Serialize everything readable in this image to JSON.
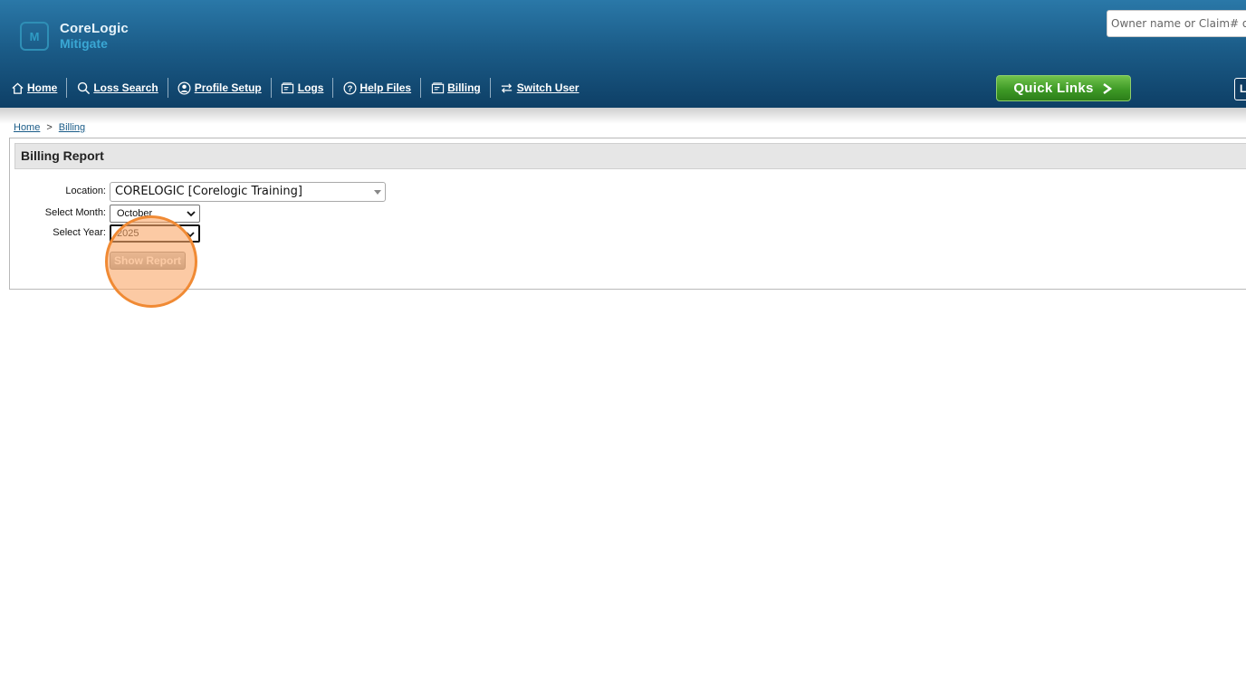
{
  "header": {
    "logo": {
      "line1": "CoreLogic",
      "line2": "Mitigate",
      "mark": "M"
    },
    "search": {
      "placeholder": "Owner name or Claim# or"
    },
    "nav": [
      {
        "id": "home",
        "label": "Home",
        "icon": "home-icon"
      },
      {
        "id": "loss-search",
        "label": "Loss Search",
        "icon": "search-icon"
      },
      {
        "id": "profile-setup",
        "label": "Profile Setup",
        "icon": "user-circle-icon"
      },
      {
        "id": "logs",
        "label": "Logs",
        "icon": "log-icon"
      },
      {
        "id": "help-files",
        "label": "Help Files",
        "icon": "help-icon"
      },
      {
        "id": "billing",
        "label": "Billing",
        "icon": "billing-icon"
      },
      {
        "id": "switch-user",
        "label": "Switch User",
        "icon": "swap-arrows-icon"
      }
    ],
    "quick_links": {
      "label": "Quick Links"
    },
    "right_button": {
      "label": "L"
    }
  },
  "breadcrumb": {
    "items": [
      "Home",
      "Billing"
    ],
    "separator": ">"
  },
  "report": {
    "title": "Billing Report",
    "location": {
      "label": "Location:",
      "value": "CORELOGIC [Corelogic Training]"
    },
    "month": {
      "label": "Select Month:",
      "value": "October"
    },
    "year": {
      "label": "Select Year:",
      "value": "2025"
    },
    "show_report_label": "Show Report"
  },
  "colors": {
    "header_top": "#2a78a8",
    "header_bottom": "#0e3f66",
    "quick_links_green": "#3e9a26",
    "link_blue": "#1b5c88",
    "highlight_orange": "#f08a34"
  }
}
